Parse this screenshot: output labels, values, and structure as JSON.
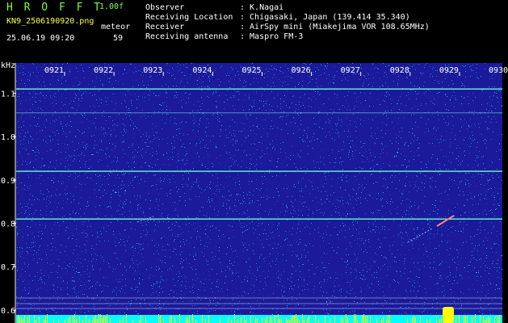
{
  "header": {
    "app_name": "H R O F F T",
    "version": "1.00f",
    "filename": "KN9_2506190920.png",
    "mode_label": "meteor",
    "count": "59",
    "datetime": "25.06.19 09:20",
    "fields": [
      {
        "label": "Observer",
        "value": ": K.Nagai"
      },
      {
        "label": "Receiving Location",
        "value": ": Chigasaki, Japan (139.414 35.340)"
      },
      {
        "label": "Receiver",
        "value": ": AirSpy mini (Miakejima VOR 108.65MHz)"
      },
      {
        "label": "Receiving antenna",
        "value": ": Maspro FM-3"
      }
    ]
  },
  "chart_data": {
    "type": "heatmap",
    "ylabel": "kHz",
    "x_ticks": [
      "0921",
      "0922",
      "0923",
      "0924",
      "0925",
      "0926",
      "0927",
      "0928",
      "0929",
      "0930"
    ],
    "y_ticks": [
      {
        "label": "1.1",
        "value": 1.1
      },
      {
        "label": "1.0",
        "value": 1.0
      },
      {
        "label": "0.9",
        "value": 0.9
      },
      {
        "label": "0.8",
        "value": 0.8
      },
      {
        "label": "0.7",
        "value": 0.7
      },
      {
        "label": "0.6",
        "value": 0.6
      }
    ],
    "ylim": [
      0.57,
      1.17
    ],
    "carrier_lines_khz": [
      1.11,
      1.055,
      0.92,
      0.81
    ],
    "colors": {
      "background": "#1a1a9a",
      "noise": "#3ec0ff",
      "carrier": "#6fffd0",
      "meteor": "#ff8080",
      "bottom_bar": "#00ffff",
      "bottom_spikes": "#ffff00"
    }
  }
}
